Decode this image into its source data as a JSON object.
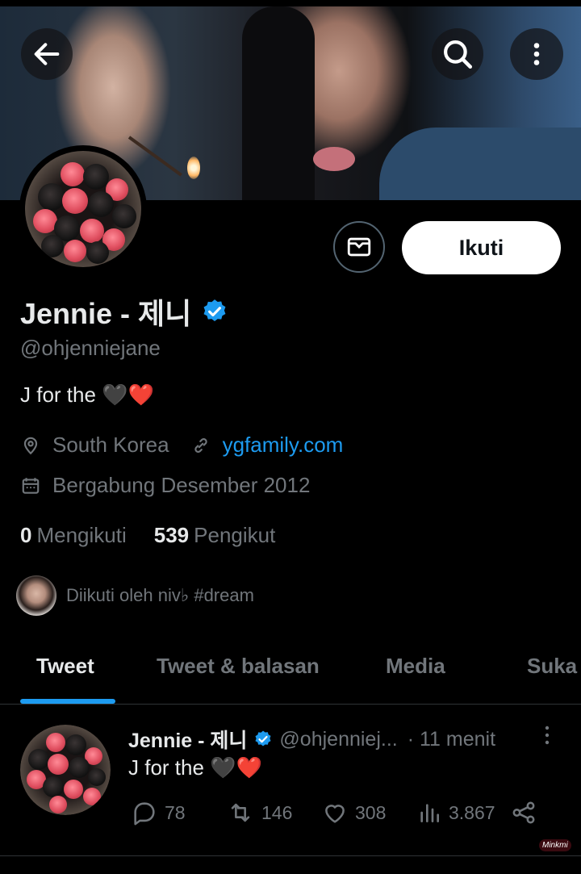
{
  "header": {
    "back_icon": "arrow-left-icon",
    "search_icon": "search-icon",
    "more_icon": "more-vertical-icon"
  },
  "profile": {
    "name": "Jennie - 제니",
    "verified_icon": "verified-badge-icon",
    "handle": "@ohjenniejane",
    "bio": "J for the 🖤❤️",
    "location": "South Korea",
    "website": "ygfamily.com",
    "joined": "Bergabung Desember 2012",
    "following_count": "0",
    "following_label": "Mengikuti",
    "followers_count": "539",
    "followers_label": "Pengikut",
    "followed_by": "Diikuti oleh niv♭ #dream"
  },
  "actions": {
    "message_icon": "mail-icon",
    "follow_label": "Ikuti"
  },
  "tabs": [
    {
      "label": "Tweet",
      "active": true
    },
    {
      "label": "Tweet & balasan",
      "active": false
    },
    {
      "label": "Media",
      "active": false
    },
    {
      "label": "Suka",
      "active": false
    }
  ],
  "tweet": {
    "name": "Jennie - 제니",
    "handle": "@ohjenniej...",
    "time": "· 11 menit",
    "text": "J for the 🖤❤️",
    "replies": "78",
    "retweets": "146",
    "likes": "308",
    "views": "3.867"
  },
  "colors": {
    "accent": "#1d9bf0",
    "background": "#000000",
    "muted_text": "#71767b",
    "primary_text": "#e7e9ea"
  }
}
